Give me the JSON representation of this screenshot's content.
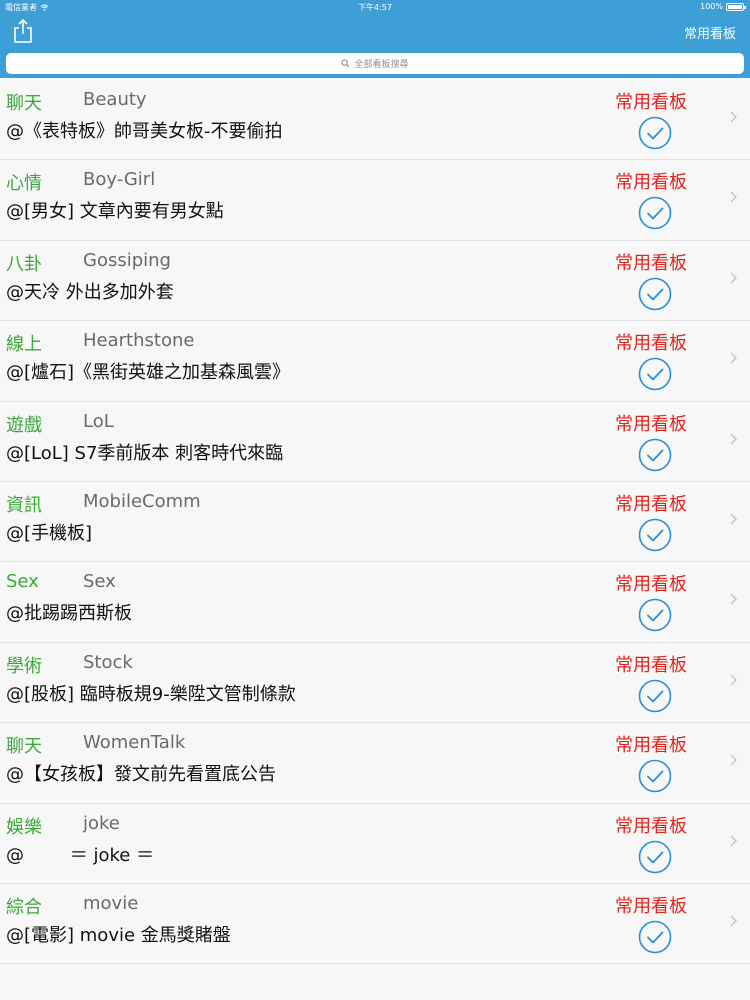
{
  "status_bar": {
    "carrier": "電信業者",
    "time": "下午4:57",
    "battery": "100%",
    "battery_level": 1.0
  },
  "nav": {
    "right_button": "常用看板",
    "share_icon": "share-icon"
  },
  "search": {
    "placeholder": "全部看板搜尋",
    "icon": "search-icon"
  },
  "colors": {
    "bar_blue": "#3e9fd6",
    "category_green": "#3aa83a",
    "favorite_red": "#e0251f",
    "check_blue": "#2c8fd6"
  },
  "boards": [
    {
      "category": "聊天",
      "name": "Beauty",
      "title": "@《表特板》帥哥美女板-不要偷拍",
      "fav_label": "常用看板"
    },
    {
      "category": "心情",
      "name": "Boy-Girl",
      "title": "@[男女] 文章內要有男女點",
      "fav_label": "常用看板"
    },
    {
      "category": "八卦",
      "name": "Gossiping",
      "title": "@天冷 外出多加外套",
      "fav_label": "常用看板"
    },
    {
      "category": "線上",
      "name": "Hearthstone",
      "title": "@[爐石]《黑街英雄之加基森風雲》",
      "fav_label": "常用看板"
    },
    {
      "category": "遊戲",
      "name": "LoL",
      "title": "@[LoL] S7季前版本 刺客時代來臨",
      "fav_label": "常用看板"
    },
    {
      "category": "資訊",
      "name": "MobileComm",
      "title": "@[手機板]",
      "fav_label": "常用看板"
    },
    {
      "category": "Sex",
      "name": "Sex",
      "title": "@批踢踢西斯板",
      "fav_label": "常用看板"
    },
    {
      "category": "學術",
      "name": "Stock",
      "title": "@[股板] 臨時板規9-樂陞文管制條款",
      "fav_label": "常用看板"
    },
    {
      "category": "聊天",
      "name": "WomenTalk",
      "title": "@【女孩板】發文前先看置底公告",
      "fav_label": "常用看板"
    },
    {
      "category": "娛樂",
      "name": "joke",
      "title": "@        ＝ joke ＝",
      "fav_label": "常用看板"
    },
    {
      "category": "綜合",
      "name": "movie",
      "title": "@[電影] movie 金馬獎賭盤",
      "fav_label": "常用看板"
    }
  ]
}
